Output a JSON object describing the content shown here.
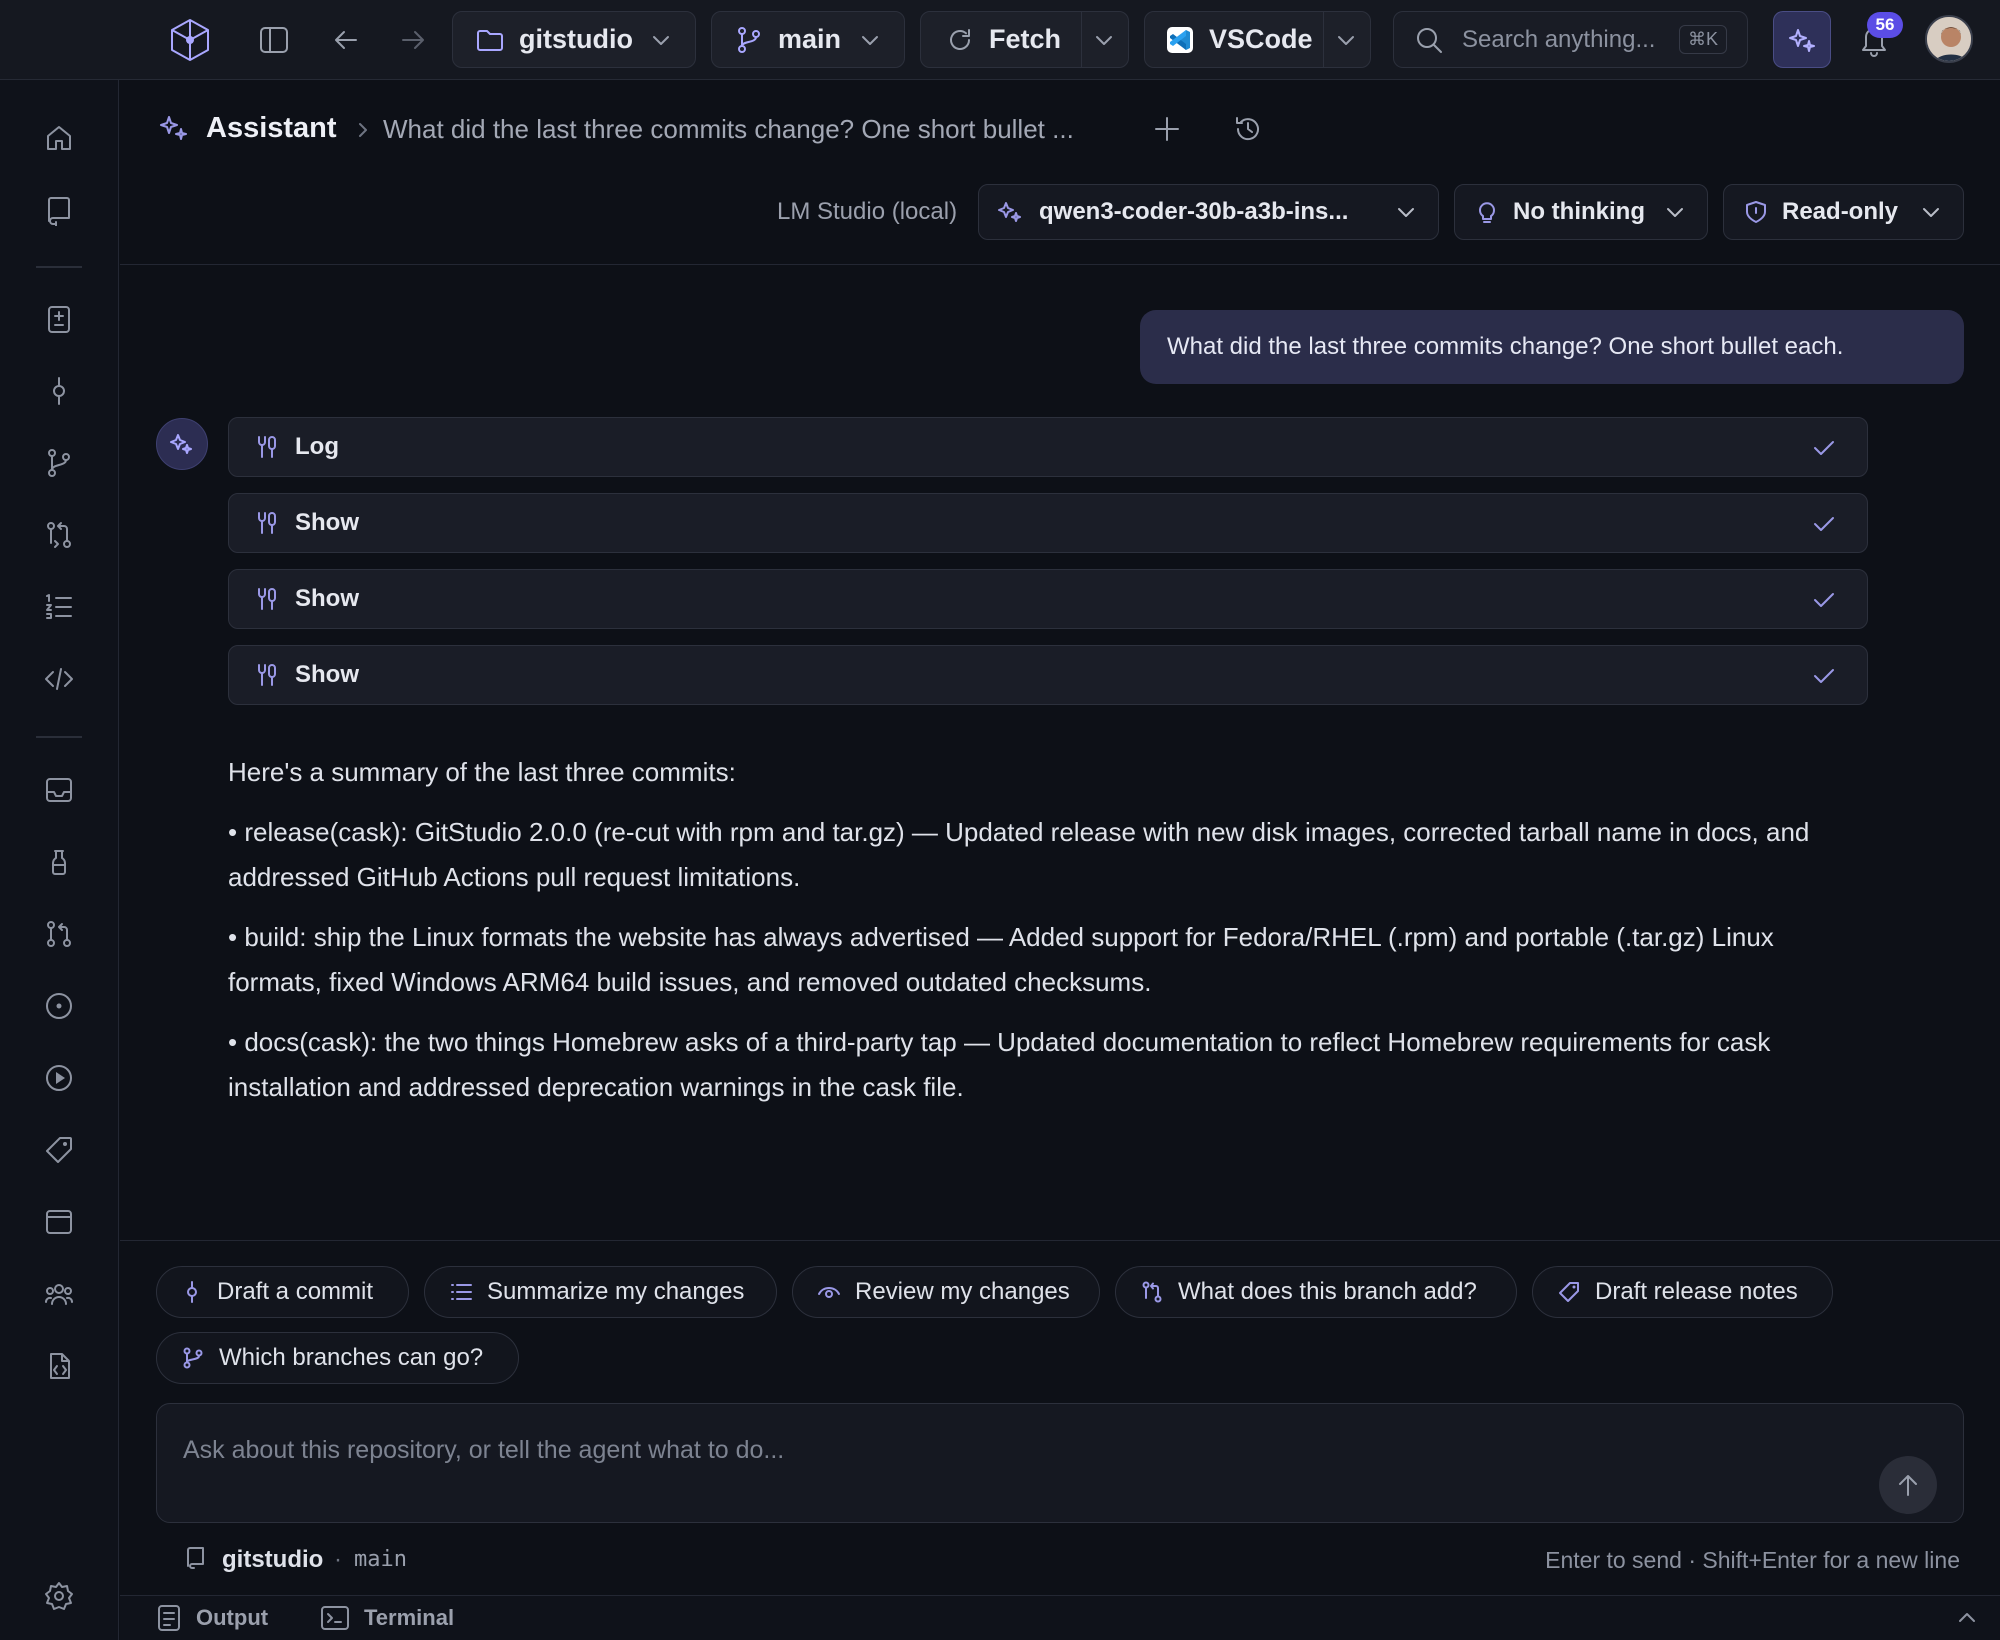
{
  "topbar": {
    "repo": "gitstudio",
    "branch": "main",
    "fetch": "Fetch",
    "editor": "VSCode",
    "search_placeholder": "Search anything...",
    "search_shortcut": "⌘K",
    "notifications_count": "56"
  },
  "header": {
    "section": "Assistant",
    "conversation_title": "What did the last three commits change? One short bullet ...",
    "provider": "LM Studio (local)",
    "model": "qwen3-coder-30b-a3b-ins...",
    "thinking": "No thinking",
    "mode": "Read-only"
  },
  "chat": {
    "user_message": "What did the last three commits change? One short bullet each.",
    "tools": [
      {
        "label": "Log"
      },
      {
        "label": "Show"
      },
      {
        "label": "Show"
      },
      {
        "label": "Show"
      }
    ],
    "answer": {
      "intro": "Here's a summary of the last three commits:",
      "bullets": [
        "• release(cask): GitStudio 2.0.0 (re-cut with rpm and tar.gz) — Updated release with new disk images, corrected tarball name in docs, and addressed GitHub Actions pull request limitations.",
        "• build: ship the Linux formats the website has always advertised — Added support for Fedora/RHEL (.rpm) and portable (.tar.gz) Linux formats, fixed Windows ARM64 build issues, and removed outdated checksums.",
        "• docs(cask): the two things Homebrew asks of a third-party tap — Updated documentation to reflect Homebrew requirements for cask installation and addressed deprecation warnings in the cask file."
      ]
    }
  },
  "suggestions": [
    "Draft a commit",
    "Summarize my changes",
    "Review my changes",
    "What does this branch add?",
    "Draft release notes",
    "Which branches can go?"
  ],
  "composer": {
    "placeholder": "Ask about this repository, or tell the agent what to do...",
    "repo": "gitstudio",
    "branch": "main",
    "hint": "Enter to send · Shift+Enter for a new line"
  },
  "statusbar": {
    "output": "Output",
    "terminal": "Terminal"
  },
  "colors": {
    "accent": "#8b8aff",
    "background": "#0d1017",
    "user_bubble": "#2b2d4a",
    "badge": "#5b4de6"
  }
}
